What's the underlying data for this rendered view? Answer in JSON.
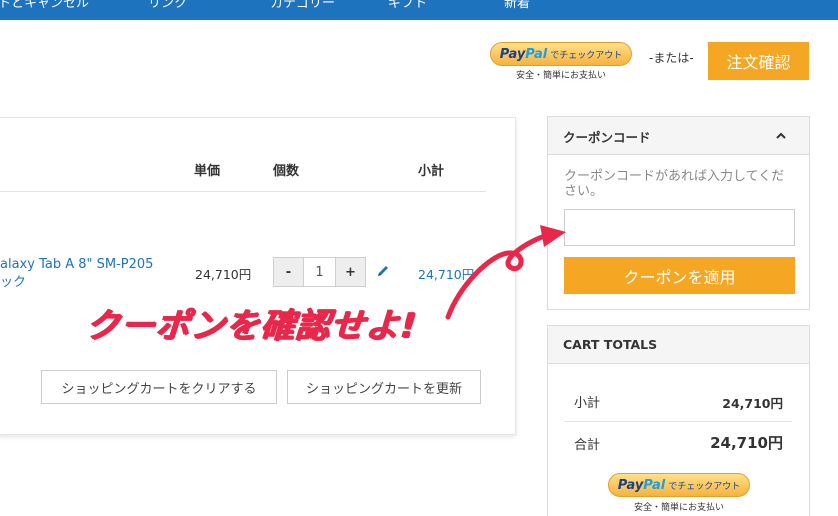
{
  "topnav": {
    "items": [
      "トとキャンセル",
      "リンク",
      "カテゴリー",
      "ギフト",
      "新着"
    ]
  },
  "paypal_top": {
    "logo_pay": "Pay",
    "logo_pal": "Pal",
    "button_text": "でチェックアウト",
    "subtext": "安全・簡単にお支払い"
  },
  "or_text": "-または-",
  "checkout_button": "注文確認",
  "cart": {
    "headers": {
      "price": "単価",
      "qty": "個数",
      "subtotal": "小計"
    },
    "item": {
      "name_line1": "alaxy Tab A 8\" SM-P205",
      "name_line2": "ック",
      "price": "24,710円",
      "qty_minus": "-",
      "qty_value": "1",
      "qty_plus": "+",
      "subtotal": "24,710円"
    },
    "clear_button": "ショッピングカートをクリアする",
    "update_button": "ショッピングカートを更新"
  },
  "coupon": {
    "title": "クーポンコード",
    "help": "クーポンコードがあれば入力してください。",
    "input_value": "",
    "input_placeholder": "",
    "apply_button": "クーポンを適用"
  },
  "totals": {
    "title": "CART TOTALS",
    "subtotal_label": "小計",
    "subtotal_value": "24,710円",
    "total_label": "合計",
    "total_value": "24,710円"
  },
  "paypal_bottom": {
    "logo_pay": "Pay",
    "logo_pal": "Pal",
    "button_text": "でチェックアウト",
    "subtext": "安全・簡単にお支払い"
  },
  "annotation": {
    "text": "クーポンを確認せよ!"
  },
  "colors": {
    "nav_blue": "#1e73be",
    "accent_orange": "#f5a623",
    "annotation_red": "#e8274b",
    "link_blue": "#1e73be"
  }
}
